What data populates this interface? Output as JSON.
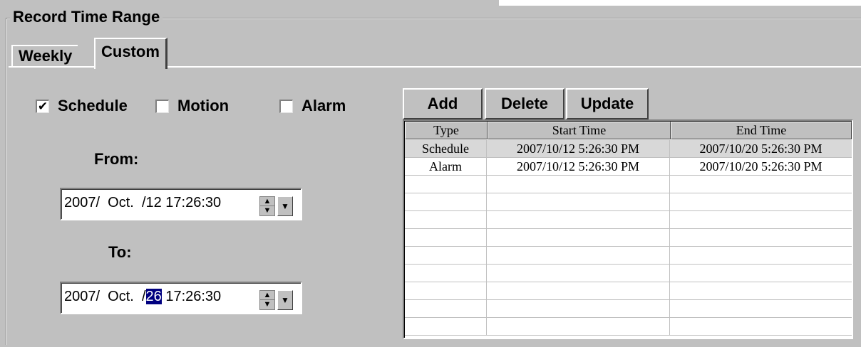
{
  "group": {
    "title": "Record Time Range"
  },
  "tabs": [
    {
      "label": "Weekly",
      "active": false
    },
    {
      "label": "Custom",
      "active": true
    }
  ],
  "checkboxes": [
    {
      "label": "Schedule",
      "checked": true
    },
    {
      "label": "Motion",
      "checked": false
    },
    {
      "label": "Alarm",
      "checked": false
    }
  ],
  "from": {
    "label": "From:",
    "value_prefix": "2007/  Oct.  /12 17:26:30",
    "selected": "",
    "value_suffix": ""
  },
  "to": {
    "label": "To:",
    "value_prefix": "2007/  Oct.  /",
    "selected": "26",
    "value_suffix": " 17:26:30"
  },
  "buttons": {
    "add": "Add",
    "delete": "Delete",
    "update": "Update"
  },
  "table": {
    "headers": [
      "Type",
      "Start Time",
      "End Time"
    ],
    "rows": [
      [
        "Schedule",
        "2007/10/12 5:26:30 PM",
        "2007/10/20 5:26:30 PM"
      ],
      [
        "Alarm",
        "2007/10/12 5:26:30 PM",
        "2007/10/20 5:26:30 PM"
      ]
    ],
    "selected_row": 0
  },
  "icons": {
    "spin_up": "▲",
    "spin_down": "▼",
    "dropdown": "▼",
    "check": "✔"
  },
  "colors": {
    "face": "#c0c0c0",
    "selection": "#000080"
  }
}
